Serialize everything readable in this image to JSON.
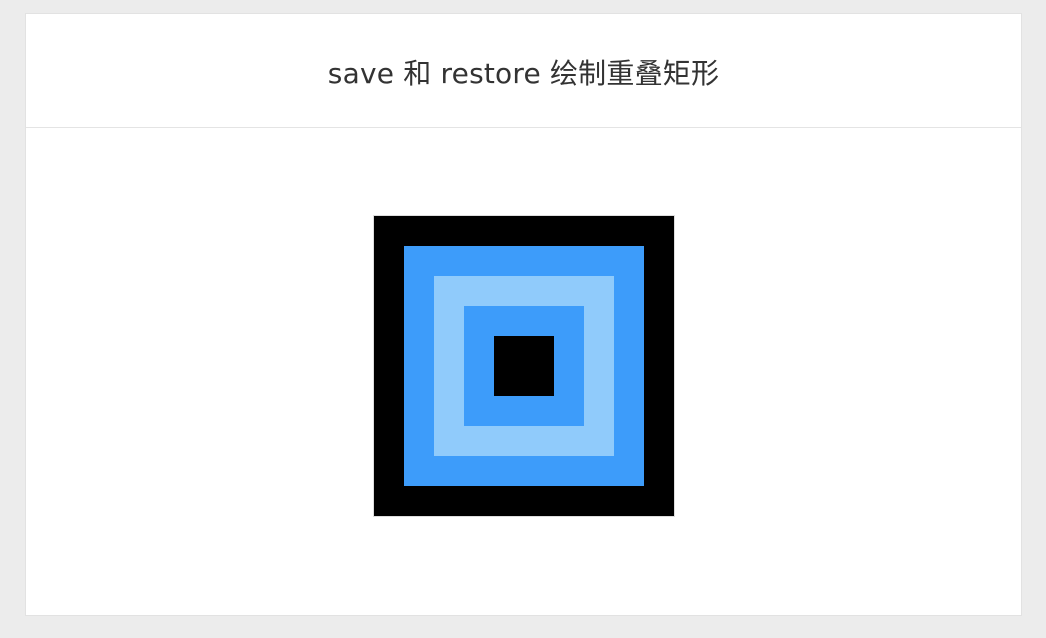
{
  "header": {
    "title": "save 和 restore 绘制重叠矩形"
  },
  "canvas": {
    "layers": [
      {
        "name": "outer-black",
        "color": "#000000"
      },
      {
        "name": "blue",
        "color": "#3d9cfa"
      },
      {
        "name": "light-blue",
        "color": "#90cbfb"
      },
      {
        "name": "blue-inner",
        "color": "#3d9cfa"
      },
      {
        "name": "black-center",
        "color": "#000000"
      }
    ]
  }
}
